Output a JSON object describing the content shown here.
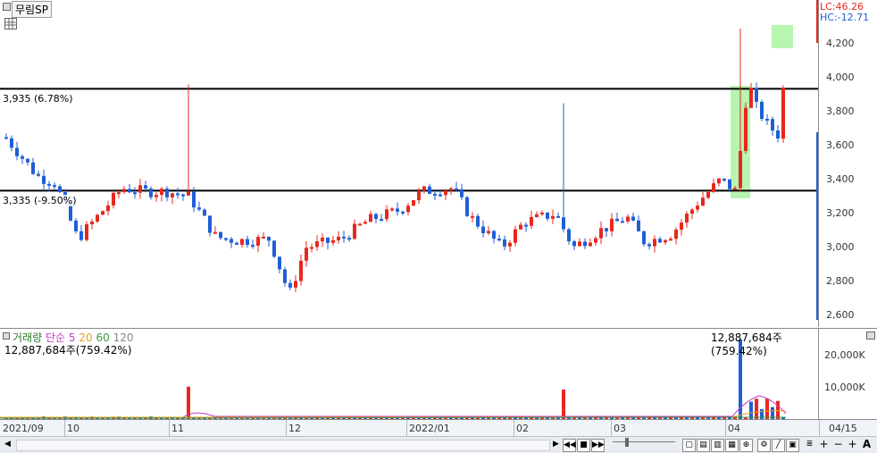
{
  "title": "무림SP",
  "price_axis": {
    "ticks": [
      "4,200",
      "4,000",
      "3,800",
      "3,600",
      "3,400",
      "3,200",
      "3,000",
      "2,800",
      "2,600"
    ],
    "lc_label": "LC:46.26",
    "hc_label": "HC:-12.71"
  },
  "lines": [
    {
      "label": "3,935 (6.78%)",
      "price": 3935
    },
    {
      "label": "3,335 (-9.50%)",
      "price": 3335
    }
  ],
  "volume": {
    "legend": {
      "title": "거래량",
      "ma_label": "단순",
      "p5": "5",
      "p20": "20",
      "p60": "60",
      "p120": "120"
    },
    "left_value": "12,887,684주(759.42%)",
    "right_value": "12,887,684주(759.42%)",
    "ticks": [
      "20,000K",
      "10,000K"
    ]
  },
  "date_axis": {
    "labels": [
      "2021/09",
      "10",
      "11",
      "12",
      "2022/01",
      "02",
      "03",
      "04"
    ],
    "right_label": "04/15"
  },
  "colors": {
    "up": "#e8281e",
    "down": "#1f5fd6",
    "highlight": "#b7f5b0",
    "ma5": "#c43ac4",
    "ma20": "#e0a020",
    "ma60": "#3a9a3a"
  },
  "toolbar": {
    "icons": [
      "back-icon",
      "rewind-icon",
      "stop-icon",
      "forward-icon"
    ]
  }
}
